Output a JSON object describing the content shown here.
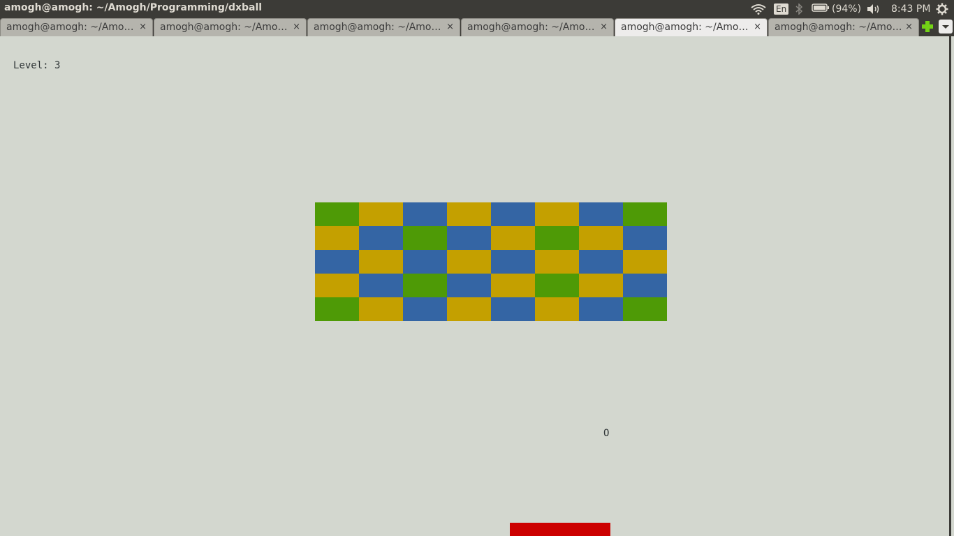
{
  "window": {
    "title": "amogh@amogh: ~/Amogh/Programming/dxball"
  },
  "indicators": {
    "keyboard": "En",
    "battery": "(94%)",
    "clock": "8:43 PM"
  },
  "tabs": [
    {
      "label": "amogh@amogh: ~/Amo…",
      "close": "×",
      "active": false
    },
    {
      "label": "amogh@amogh: ~/Amo…",
      "close": "×",
      "active": false
    },
    {
      "label": "amogh@amogh: ~/Amo…",
      "close": "×",
      "active": false
    },
    {
      "label": "amogh@amogh: ~/Amo…",
      "close": "×",
      "active": false
    },
    {
      "label": "amogh@amogh: ~/Amo…",
      "close": "×",
      "active": true
    },
    {
      "label": "amogh@amogh: ~/Amo…",
      "close": "×",
      "active": false
    }
  ],
  "game": {
    "level_text": "Level: 3",
    "ball_char": "O",
    "colors": {
      "green": "#4e9a06",
      "yellow": "#c4a000",
      "blue": "#3465a4",
      "paddle": "#cc0000"
    },
    "bricks": [
      [
        "green",
        "yellow",
        "blue",
        "yellow",
        "blue",
        "yellow",
        "blue",
        "green"
      ],
      [
        "yellow",
        "blue",
        "green",
        "blue",
        "yellow",
        "green",
        "yellow",
        "blue"
      ],
      [
        "blue",
        "yellow",
        "blue",
        "yellow",
        "blue",
        "yellow",
        "blue",
        "yellow"
      ],
      [
        "yellow",
        "blue",
        "green",
        "blue",
        "yellow",
        "green",
        "yellow",
        "blue"
      ],
      [
        "green",
        "yellow",
        "blue",
        "yellow",
        "blue",
        "yellow",
        "blue",
        "green"
      ]
    ]
  }
}
